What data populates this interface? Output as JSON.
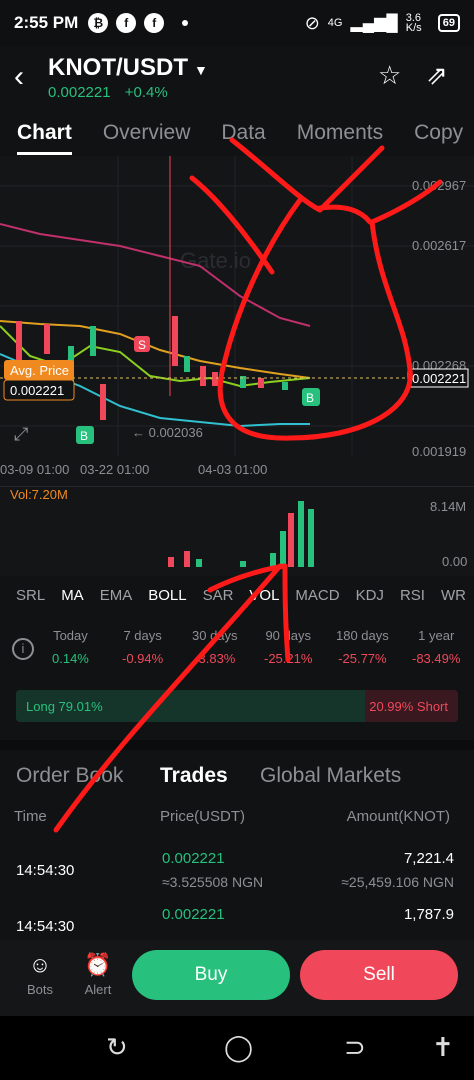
{
  "status": {
    "time": "2:55 PM",
    "net": "4G",
    "speed": "3.6 K/s",
    "battery": "69"
  },
  "header": {
    "pair": "KNOT/USDT",
    "price": "0.002221",
    "change": "+0.4%"
  },
  "tabs": [
    "Chart",
    "Overview",
    "Data",
    "Moments",
    "Copy"
  ],
  "chart": {
    "yticks": [
      "0.002967",
      "0.002617",
      "0.002268",
      "0.001919"
    ],
    "xticks": [
      "03-09 01:00",
      "03-22 01:00",
      "04-03 01:00"
    ],
    "avg_price_label": "Avg. Price",
    "avg_price_value": "0.002221",
    "last_price_tag": "0.002221",
    "low_marker": "← 0.002036",
    "watermark": "Gate.io",
    "vol_label": "Vol:7.20M",
    "vol_max": "8.14M",
    "vol_min": "0.00",
    "buy_marker": "B",
    "sell_marker": "S"
  },
  "chart_data": {
    "type": "candlestick",
    "ylim": [
      0.001919,
      0.002967
    ],
    "ma_lines": [
      "MA",
      "BOLL"
    ]
  },
  "indicators": [
    "SRL",
    "MA",
    "EMA",
    "BOLL",
    "SAR",
    "VOL",
    "MACD",
    "KDJ",
    "RSI",
    "WR"
  ],
  "performance": [
    {
      "label": "Today",
      "value": "0.14%",
      "dir": "up"
    },
    {
      "label": "7 days",
      "value": "-0.94%",
      "dir": "down"
    },
    {
      "label": "30 days",
      "value": "-3.83%",
      "dir": "down"
    },
    {
      "label": "90 days",
      "value": "-25.21%",
      "dir": "down"
    },
    {
      "label": "180 days",
      "value": "-25.77%",
      "dir": "down"
    },
    {
      "label": "1 year",
      "value": "-83.49%",
      "dir": "down"
    }
  ],
  "ratio": {
    "long": "Long 79.01%",
    "short": "20.99% Short",
    "long_pct": 79.01
  },
  "order_tabs": [
    "Order Book",
    "Trades",
    "Global Markets"
  ],
  "table_headers": {
    "time": "Time",
    "price": "Price(USDT)",
    "amount": "Amount(KNOT)"
  },
  "trades": [
    {
      "time": "14:54:30",
      "price": "0.002221",
      "price_ngn": "≈3.525508 NGN",
      "amount": "7,221.4",
      "amount_ngn": "≈25,459.106 NGN"
    },
    {
      "time": "14:54:30",
      "price": "0.002221",
      "price_ngn": "",
      "amount": "1,787.9",
      "amount_ngn": ""
    }
  ],
  "bottom": {
    "bots": "Bots",
    "alert": "Alert",
    "buy": "Buy",
    "sell": "Sell"
  },
  "colors": {
    "green": "#27c07d",
    "red": "#f0485a",
    "annotation": "#ff1a1a"
  }
}
